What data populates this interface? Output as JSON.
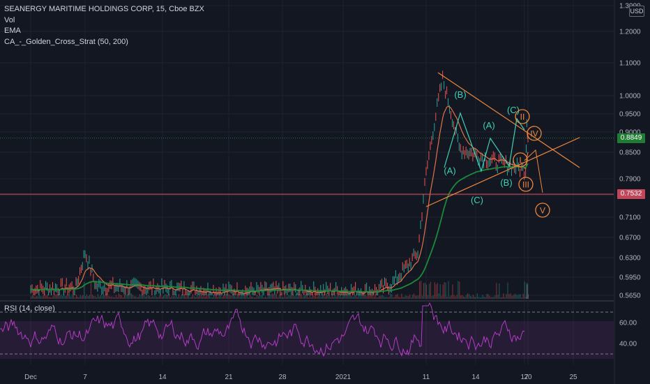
{
  "header": {
    "symbol_line": "SEANERGY MARITIME HOLDINGS CORP, 15, Cboe BZX",
    "indicators": [
      "Vol",
      "EMA",
      "CA_-_Golden_Cross_Strat (50, 200)"
    ]
  },
  "currency_badge": "USD",
  "price_tags": [
    {
      "label": "0.8849",
      "value": 0.8849,
      "color": "#1e7d32"
    },
    {
      "label": "0.7532",
      "value": 0.7532,
      "color": "#c2465a"
    }
  ],
  "rsi_panel": {
    "title": "RSI (14, close)",
    "levels": [
      30,
      40,
      60,
      70
    ],
    "ticks": [
      "60.00",
      "40.00"
    ]
  },
  "colors": {
    "background": "#131722",
    "ema_slow": "#1b8a3a",
    "ema_fast": "#e0734a",
    "rsi": "#b23bc4",
    "wave_teal": "#3fd0b5",
    "wave_orange": "#f0873a",
    "hline": "#e15264"
  },
  "chart_data": {
    "type": "candlestick",
    "title": "SEANERGY MARITIME HOLDINGS CORP, 15, Cboe BZX",
    "y_axis": {
      "scale": "log",
      "ticks": [
        "1.3000",
        "1.2000",
        "1.1000",
        "1.0000",
        "0.9500",
        "0.9000",
        "0.8500",
        "0.7900",
        "0.7500",
        "0.7100",
        "0.6700",
        "0.6300",
        "0.5950",
        "0.5650"
      ]
    },
    "x_axis": {
      "ticks": [
        "Dec",
        "7",
        "14",
        "21",
        "28",
        "2021",
        "11",
        "14",
        "17",
        "20",
        "25"
      ]
    },
    "price_path": [
      {
        "date": "Dec 1",
        "price": 0.575
      },
      {
        "date": "Dec 6",
        "price": 0.578
      },
      {
        "date": "Dec 7",
        "price": 0.64
      },
      {
        "date": "Dec 8",
        "price": 0.58
      },
      {
        "date": "Dec 21",
        "price": 0.572
      },
      {
        "date": "Jan 5",
        "price": 0.572
      },
      {
        "date": "Jan 7",
        "price": 0.585
      },
      {
        "date": "Jan 9",
        "price": 0.62
      },
      {
        "date": "Jan 10",
        "price": 0.64
      },
      {
        "date": "Jan 11",
        "price": 0.8
      },
      {
        "date": "Jan 12",
        "price": 1.05
      },
      {
        "date": "Jan 13",
        "price": 0.86
      },
      {
        "date": "Jan 15",
        "price": 0.83
      },
      {
        "date": "Jan 18",
        "price": 0.81
      },
      {
        "date": "Jan 19",
        "price": 0.93
      },
      {
        "date": "Jan 20",
        "price": 0.885
      }
    ],
    "horizontal_line": 0.7532,
    "last_price": 0.8849,
    "wave_labels_teal": [
      "(B)",
      "(A)",
      "(C)",
      "(A)",
      "(C)",
      "(B)"
    ],
    "wave_labels_orange": [
      "II",
      "IV",
      "I",
      "III",
      "V"
    ]
  }
}
